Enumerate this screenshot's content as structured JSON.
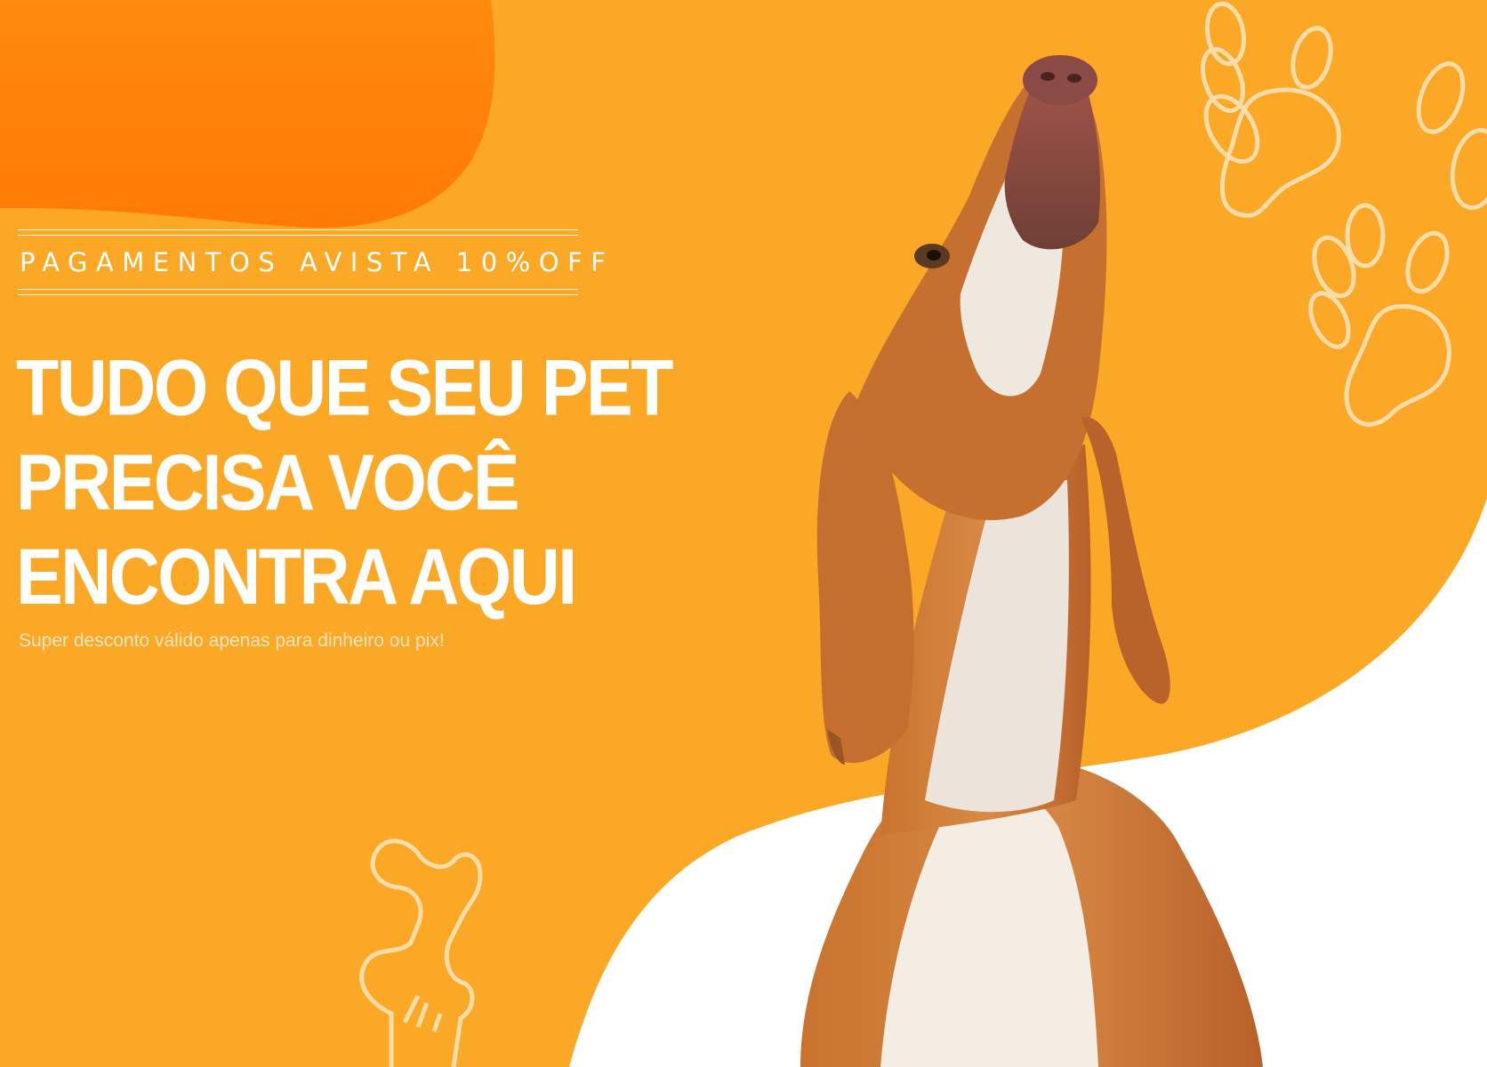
{
  "banner": {
    "promo_label": "PAGAMENTOS AVISTA 10%OFF",
    "headline_lines": [
      "TUDO QUE SEU PET",
      "PRECISA VOCÊ",
      "ENCONTRA AQUI"
    ],
    "subtext": "Super desconto válido apenas para dinheiro ou pix!"
  },
  "colors": {
    "background_orange": "#fba827",
    "blob_orange": "#ff7d0a",
    "text_white": "#ffffff",
    "decoration_cream": "#fde6bf"
  },
  "decorations": [
    "paw-print-icon",
    "paw-print-icon",
    "bone-icon"
  ],
  "image": "beagle-dog-photo"
}
